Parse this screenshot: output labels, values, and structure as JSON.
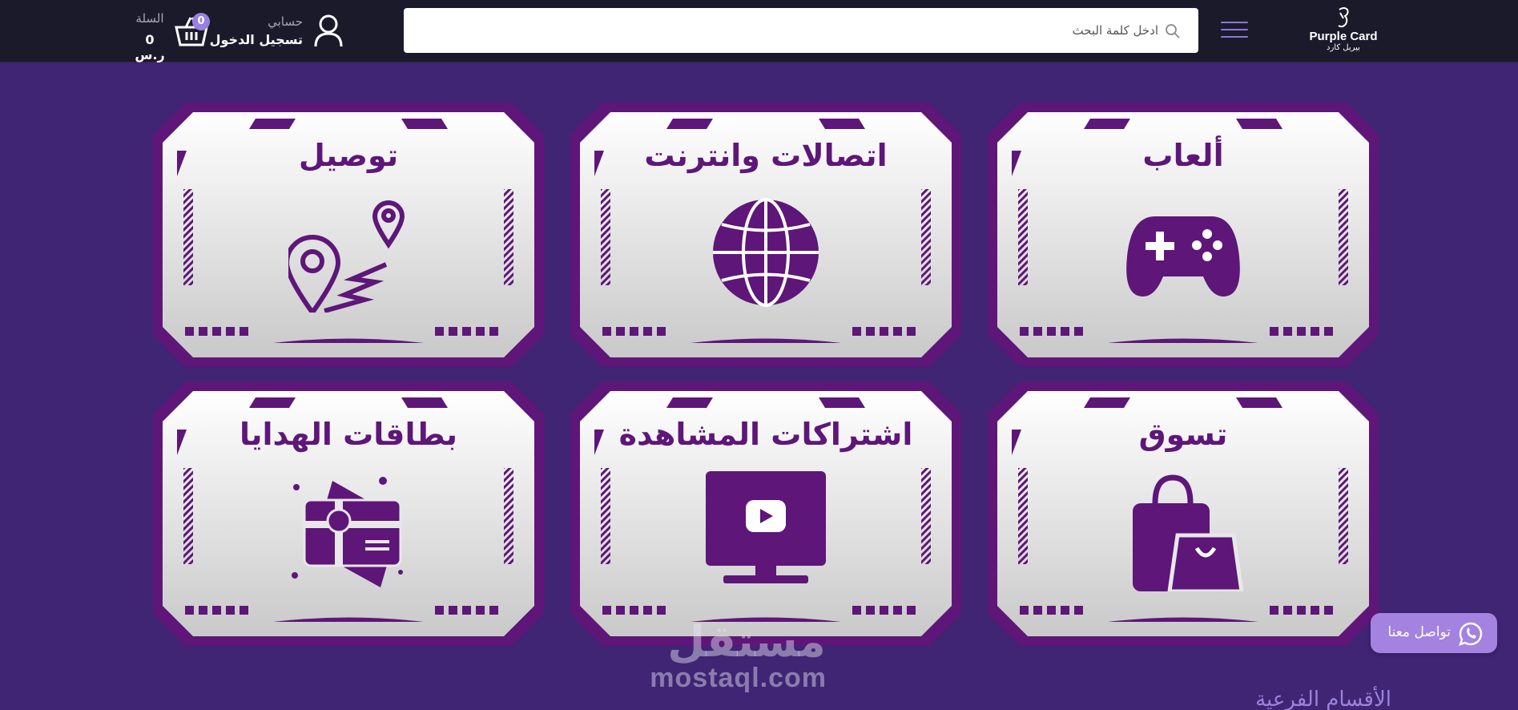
{
  "header": {
    "logo_en": "Purple Card",
    "logo_ar": "بيربل كارد",
    "search_placeholder": "ادخل كلمة البحث",
    "account_label": "حسابي",
    "login_label": "تسجيل الدخول",
    "cart_label": "السلة",
    "cart_total": "0 ر.س",
    "cart_count": "0"
  },
  "categories": [
    {
      "title": "ألعاب",
      "icon": "gamepad-icon"
    },
    {
      "title": "اتصالات وانترنت",
      "icon": "globe-icon"
    },
    {
      "title": "توصيل",
      "icon": "location-pin-icon"
    },
    {
      "title": "تسوق",
      "icon": "shopping-bags-icon"
    },
    {
      "title": "اشتراكات المشاهدة",
      "icon": "tv-play-icon"
    },
    {
      "title": "بطاقات الهدايا",
      "icon": "gift-card-icon"
    }
  ],
  "contact": {
    "label": "تواصل معنا",
    "icon": "whatsapp-icon"
  },
  "watermark": {
    "ar": "مستقل",
    "en": "mostaql.com"
  },
  "subcategories_heading": "الأقسام الفرعية",
  "colors": {
    "header_bg": "#1b1a2b",
    "page_bg": "#3f2574",
    "card_purple": "#5e1679",
    "accent": "#a482e0"
  }
}
